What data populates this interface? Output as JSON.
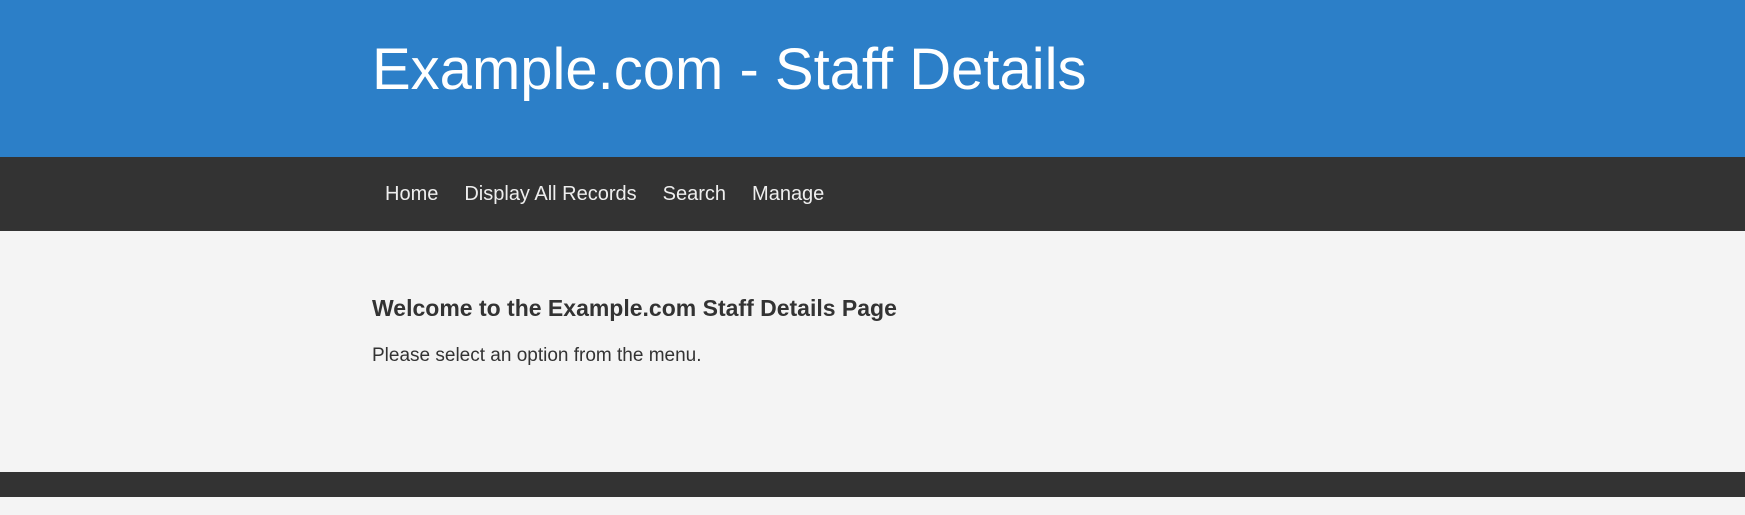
{
  "header": {
    "title": "Example.com - Staff Details"
  },
  "nav": {
    "items": [
      {
        "label": "Home"
      },
      {
        "label": "Display All Records"
      },
      {
        "label": "Search"
      },
      {
        "label": "Manage"
      }
    ]
  },
  "main": {
    "heading": "Welcome to the Example.com Staff Details Page",
    "text": "Please select an option from the menu."
  },
  "colors": {
    "header_background": "#2c7fc8",
    "nav_background": "#333333",
    "page_background": "#f4f4f4",
    "footer_background": "#333333"
  }
}
